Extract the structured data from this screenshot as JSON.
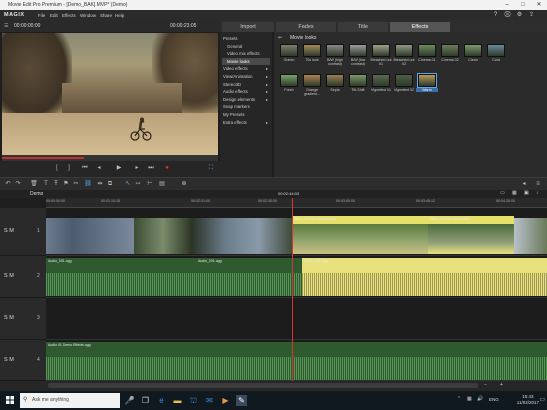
{
  "window": {
    "title": "Movie Edit Pro Premium - [Demo_BAK].MVP* (Demo)"
  },
  "menu": {
    "logo": "MAGIX",
    "items": [
      "File",
      "Edit",
      "Effects",
      "Window",
      "Share",
      "Help"
    ]
  },
  "preview": {
    "timecode_left": "00:00:00:00",
    "timecode_right": "00:00:23:05",
    "progress": 0.38
  },
  "media_pool": {
    "tabs": [
      "Import",
      "Fades",
      "Title",
      "Effects"
    ],
    "active_tab": "Effects",
    "breadcrumb": "Movie looks",
    "categories": [
      {
        "label": "Presets",
        "sub": false,
        "arrow": ""
      },
      {
        "label": "General",
        "sub": true,
        "arrow": ""
      },
      {
        "label": "Video mix effects",
        "sub": true,
        "arrow": ""
      },
      {
        "label": "Movie looks",
        "sub": true,
        "arrow": "",
        "selected": true
      },
      {
        "label": "Video effects",
        "sub": false,
        "arrow": "▸"
      },
      {
        "label": "View/Animation",
        "sub": false,
        "arrow": "▸"
      },
      {
        "label": "Stereo3D",
        "sub": false,
        "arrow": "▸"
      },
      {
        "label": "Audio effects",
        "sub": false,
        "arrow": "▸"
      },
      {
        "label": "Design elements",
        "sub": false,
        "arrow": "▸"
      },
      {
        "label": "Snap markers",
        "sub": false,
        "arrow": ""
      },
      {
        "label": "My Presets",
        "sub": false,
        "arrow": ""
      },
      {
        "label": "Extra effects",
        "sub": false,
        "arrow": "▸"
      }
    ],
    "looks_row1": [
      {
        "label": "Grimm",
        "color": "#7d7e6e"
      },
      {
        "label": "70s look",
        "color": "#a08a5a"
      },
      {
        "label": "B/W (high contrast)",
        "color": "#8a8a8a"
      },
      {
        "label": "B/W (low contrast)",
        "color": "#9c9c9c"
      },
      {
        "label": "Bleached out 01",
        "color": "#a2a08a"
      },
      {
        "label": "Bleached out 02",
        "color": "#8f9a86"
      },
      {
        "label": "Cinema 01",
        "color": "#6b8a60"
      },
      {
        "label": "Cinema 02",
        "color": "#6e7e5a"
      },
      {
        "label": "Clean",
        "color": "#7a9a6a"
      },
      {
        "label": "Cold",
        "color": "#6a8a9a"
      }
    ],
    "looks_row2": [
      {
        "label": "Fresh",
        "color": "#7aa26a"
      },
      {
        "label": "Orange gradient...",
        "color": "#b08050"
      },
      {
        "label": "Sepia",
        "color": "#9a7e56"
      },
      {
        "label": "Tilt-Shift",
        "color": "#7e9868"
      },
      {
        "label": "Vignetted 01",
        "color": "#5a6a4e"
      },
      {
        "label": "Vignetted 02",
        "color": "#4e5e44"
      },
      {
        "label": "Warm",
        "color": "#b89a60",
        "selected": true
      }
    ]
  },
  "timeline": {
    "project_tab": "Demo",
    "playhead_time": "00:02:44:03",
    "ruler": [
      "00:00:00:00",
      "00:01:10:15",
      "00:02:01:00",
      "00:02:30:00",
      "00:03:00:00",
      "00:03:45:12",
      "00:04:30:00"
    ],
    "tracks": [
      {
        "label": "S M",
        "num": "1"
      },
      {
        "label": "S M",
        "num": "2"
      },
      {
        "label": "S M",
        "num": "3"
      },
      {
        "label": "S M",
        "num": "4"
      }
    ],
    "clip_names": {
      "video_a": "",
      "video_b": "Rider 003.mov   Kinocamera",
      "video_c": "Rider 003.mov   Sakuratan",
      "audio_a": "Audio_001.ogg",
      "audio_b": "Audio_001.ogg",
      "audio_c": "Audio_001.ogg",
      "music": "Audio 01 Demo Effects.ogg"
    }
  },
  "taskbar": {
    "search_placeholder": "Ask me anything",
    "language": "ENG",
    "time": "15:43",
    "date": "11/02/2017"
  },
  "colors": {
    "accent": "#4a86c8",
    "playhead": "#dd3333",
    "audio_green": "#2f5a2f",
    "selected_yellow": "#e8e07a"
  }
}
